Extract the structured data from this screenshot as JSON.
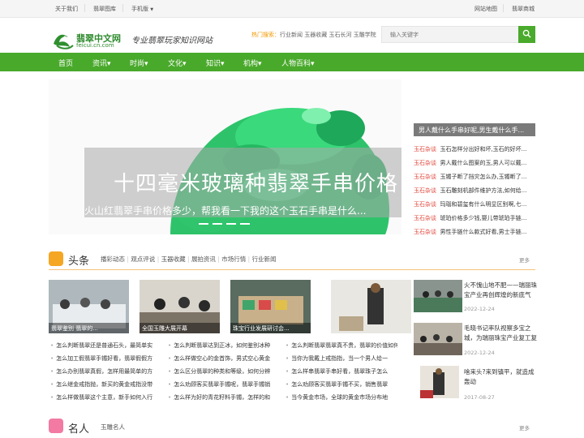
{
  "topbar": {
    "about": "关于我们",
    "gallery": "翡翠图库",
    "mobile": "手机版",
    "sitemap": "网站地图",
    "mall": "翡翠商城"
  },
  "header": {
    "logo_cn": "翡翠中文网",
    "logo_en": "feicui.cn.com",
    "slogan": "专业翡翠玩家知识网站",
    "hot_label": "热门搜索：",
    "hot_terms": "行业新闻 玉器收藏 玉石长河 玉雕学院",
    "search_placeholder": "输入关键字"
  },
  "nav": [
    "首页",
    "资讯▾",
    "时尚▾",
    "文化▾",
    "知识▾",
    "机构▾",
    "人物百科▾"
  ],
  "banner": {
    "big_text": "十四毫米玻璃种翡翠手串价格",
    "title": "火山红翡翠手串价格多少，帮我看一下我的这个玉石手串是什么..."
  },
  "right_list": {
    "head": "男人戴什么手串好呢,男生戴什么手...",
    "items": [
      {
        "tag": "玉石杂谈",
        "text": "玉石怎样分出好和坏,玉石的好坏..."
      },
      {
        "tag": "玉石杂谈",
        "text": "男人戴什么图案的玉,男人可以戴..."
      },
      {
        "tag": "玉石杂谈",
        "text": "玉镯子断了挡灾怎么办,玉镯断了..."
      },
      {
        "tag": "玉石杂谈",
        "text": "玉石雕刻机部件维护方法,如何给..."
      },
      {
        "tag": "玉石杂谈",
        "text": "玛瑙和碧玺有什么明显区别啊,七..."
      },
      {
        "tag": "玉石杂谈",
        "text": "琥珀价格多少钱,婴儿带琥珀手链..."
      },
      {
        "tag": "玉石杂谈",
        "text": "男性手链什么款式好看,男士手链..."
      }
    ]
  },
  "headlines": {
    "title": "头条",
    "tabs": [
      "播彩动态",
      "观点评说",
      "玉器收藏",
      "展拍资讯",
      "市场行情",
      "行业新闻"
    ],
    "more": "更多",
    "thumbs": [
      {
        "caption": "翡翠鉴别 翡翠的..."
      },
      {
        "caption": "全国玉雕大展开幕"
      },
      {
        "caption": "珠宝行业发展研讨会..."
      },
      {
        "caption": ""
      }
    ],
    "col1": [
      "怎么判断翡翠还是普通石头，最简单实",
      "怎么加工假翡翠手镯好看，翡翠假假方",
      "怎么办别翡翠真假，怎样用最简单的方",
      "怎么继金戒指抛，新买的黄金戒指没带",
      "怎么样做翡翠这个主意，新手如何入行"
    ],
    "col2": [
      "怎么判断翡翠达到正冰，如何鉴别冰种",
      "怎么样做空心的金首饰，男式空心黄金",
      "怎么区分翡翠的种类和等级，如何分辨",
      "怎么劝顾客买翡翠手镯呢，翡翠手镯销",
      "怎么样为好的青花籽料手镯，怎样的和"
    ],
    "col3": [
      "怎么判断翡翠翡翠真不贵，翡翠的价值如何",
      "当你为我戴上戒指指，当一个男人给一",
      "怎么样串翡翠手串好看，翡翠珠子怎么",
      "怎么劝顾客买翡翠手镯不买，销售翡翠",
      "当今黄金市场，全球的黄金市场分布地"
    ],
    "side": [
      {
        "title": "火不愧山地不肥——瑞丽珠宝产业再创辉煌的新底气",
        "date": "2022-12-24"
      },
      {
        "title": "毛晓书记率队视察多宝之城，为瑞丽珠宝产业复工复",
        "date": "2022-12-24"
      },
      {
        "title": "啥来头?来到镇平，就造成轰动",
        "date": "2017-08-27"
      }
    ]
  },
  "people": {
    "title": "名人",
    "tab": "玉雕名人",
    "more": "更多"
  },
  "colors": {
    "brand_green": "#49a92b",
    "headline_icon": "#f5a623",
    "people_icon": "#f27aa3",
    "tag_red": "#e0483c"
  }
}
